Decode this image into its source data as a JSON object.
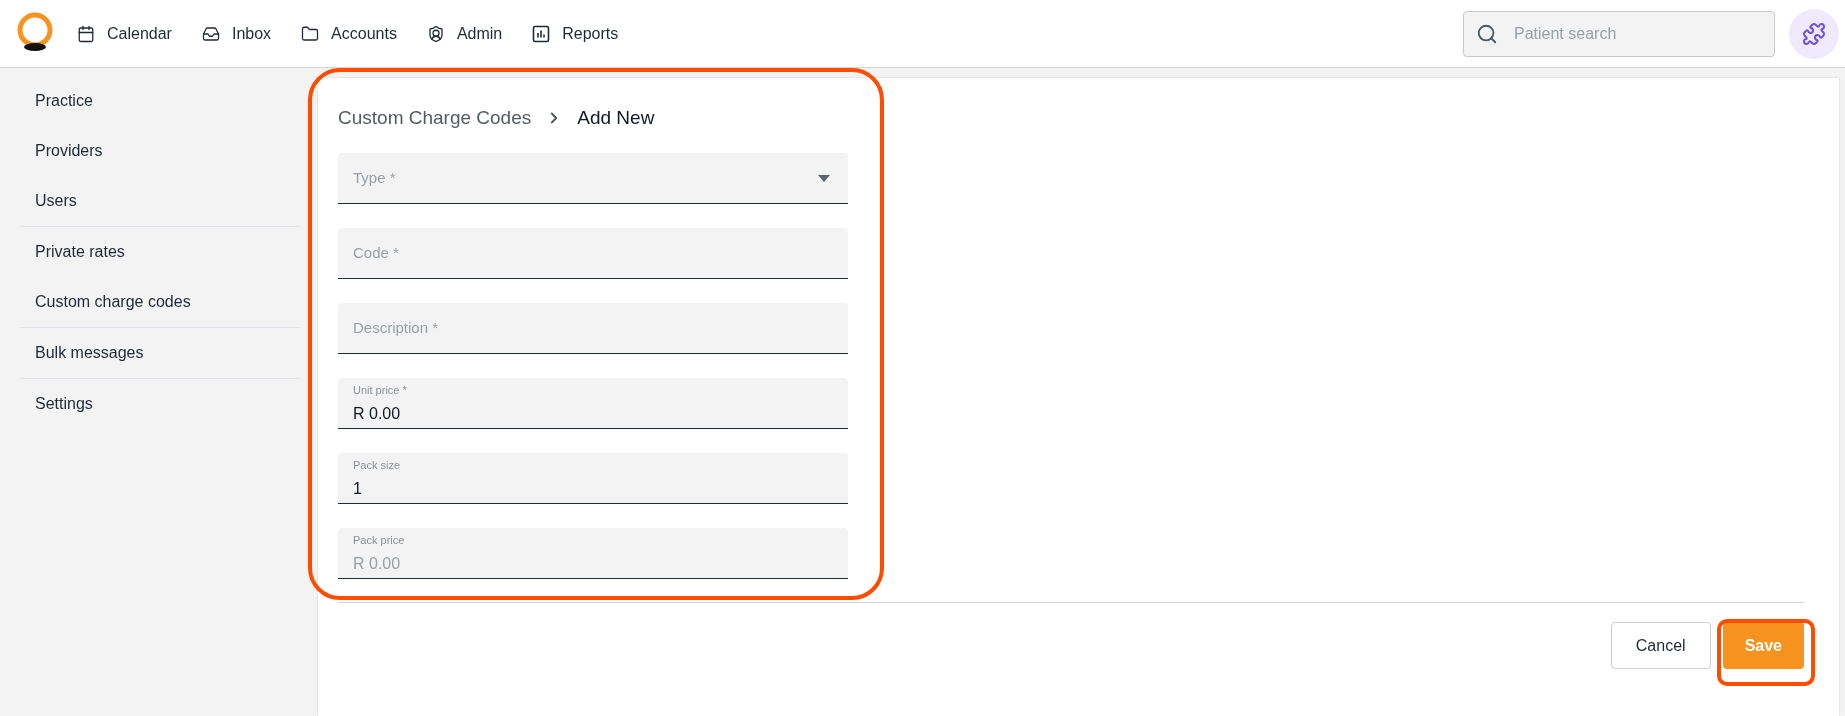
{
  "nav": {
    "items": [
      {
        "kind": "calendar",
        "label": "Calendar"
      },
      {
        "kind": "inbox",
        "label": "Inbox"
      },
      {
        "kind": "folder",
        "label": "Accounts"
      },
      {
        "kind": "admin",
        "label": "Admin"
      },
      {
        "kind": "reports",
        "label": "Reports"
      }
    ],
    "search": {
      "placeholder": "Patient search"
    }
  },
  "sidebar": {
    "sections": [
      [
        "Practice",
        "Providers",
        "Users"
      ],
      [
        "Private rates",
        "Custom charge codes"
      ],
      [
        "Bulk messages"
      ],
      [
        "Settings"
      ]
    ]
  },
  "breadcrumb": {
    "parent": "Custom Charge Codes",
    "current": "Add New"
  },
  "fields": [
    {
      "kind": "select",
      "label": "Type *"
    },
    {
      "kind": "text",
      "label": "Code *"
    },
    {
      "kind": "text",
      "label": "Description *"
    },
    {
      "kind": "text",
      "label": "Unit price *",
      "value": "R 0.00"
    },
    {
      "kind": "text",
      "label": "Pack size",
      "value": "1"
    },
    {
      "kind": "text",
      "label": "Pack price",
      "placeholder": "R 0.00"
    }
  ],
  "buttons": {
    "cancel": "Cancel",
    "save": "Save"
  }
}
